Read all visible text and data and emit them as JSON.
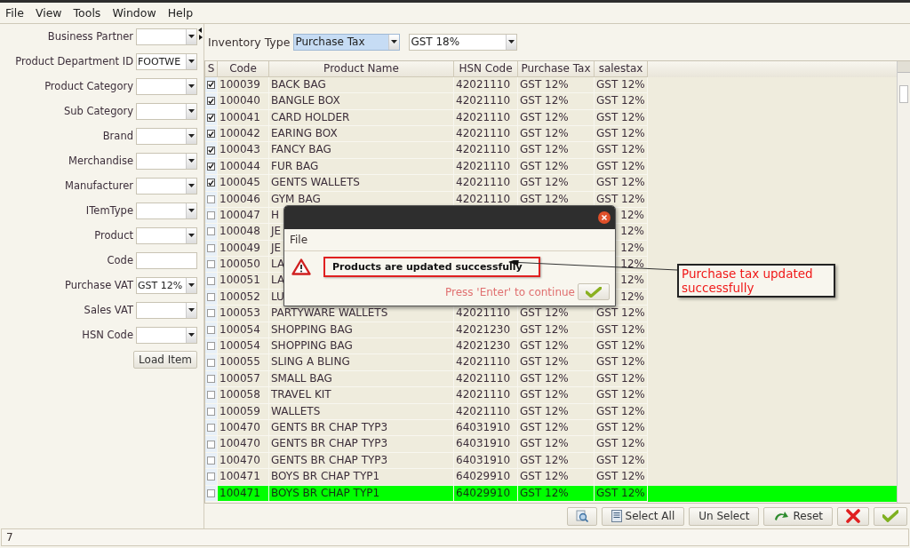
{
  "menu": [
    {
      "label": "File"
    },
    {
      "label": "View"
    },
    {
      "label": "Tools"
    },
    {
      "label": "Window"
    },
    {
      "label": "Help"
    }
  ],
  "filters": [
    {
      "label": "Business Partner",
      "kind": "combo"
    },
    {
      "label": "Product Department ID",
      "kind": "combo",
      "value": "FOOTWE"
    },
    {
      "label": "Product Category",
      "kind": "combo"
    },
    {
      "label": "Sub Category",
      "kind": "combo"
    },
    {
      "label": "Brand",
      "kind": "combo"
    },
    {
      "label": "Merchandise",
      "kind": "combo"
    },
    {
      "label": "Manufacturer",
      "kind": "combo"
    },
    {
      "label": "ITemType",
      "kind": "combo"
    },
    {
      "label": "Product",
      "kind": "combo"
    },
    {
      "label": "Code",
      "kind": "text"
    },
    {
      "label": "Purchase VAT",
      "kind": "combo",
      "value": "GST 12%"
    },
    {
      "label": "Sales VAT",
      "kind": "combo"
    },
    {
      "label": "HSN Code",
      "kind": "combo"
    }
  ],
  "load_button": "Load Item",
  "inventory": {
    "label": "Inventory Type",
    "type_value": "Purchase Tax",
    "tax_value": "GST 18%"
  },
  "table": {
    "columns": [
      "S",
      "Code",
      "Product Name",
      "HSN Code",
      "Purchase Tax",
      "salestax"
    ],
    "rows": [
      {
        "checked": true,
        "selected": false,
        "code": "100039",
        "name": "BACK BAG",
        "hsn": "42021110",
        "purchase_tax": "GST 12%",
        "salestax": "GST 12%"
      },
      {
        "checked": true,
        "selected": false,
        "code": "100040",
        "name": "BANGLE BOX",
        "hsn": "42021110",
        "purchase_tax": "GST 12%",
        "salestax": "GST 12%"
      },
      {
        "checked": true,
        "selected": false,
        "code": "100041",
        "name": "CARD HOLDER",
        "hsn": "42021110",
        "purchase_tax": "GST 12%",
        "salestax": "GST 12%"
      },
      {
        "checked": true,
        "selected": false,
        "code": "100042",
        "name": "EARING BOX",
        "hsn": "42021110",
        "purchase_tax": "GST 12%",
        "salestax": "GST 12%"
      },
      {
        "checked": true,
        "selected": false,
        "code": "100043",
        "name": "FANCY BAG",
        "hsn": "42021110",
        "purchase_tax": "GST 12%",
        "salestax": "GST 12%"
      },
      {
        "checked": true,
        "selected": false,
        "code": "100044",
        "name": "FUR BAG",
        "hsn": "42021110",
        "purchase_tax": "GST 12%",
        "salestax": "GST 12%"
      },
      {
        "checked": true,
        "selected": false,
        "code": "100045",
        "name": "GENTS WALLETS",
        "hsn": "42021110",
        "purchase_tax": "GST 12%",
        "salestax": "GST 12%"
      },
      {
        "checked": false,
        "selected": false,
        "code": "100046",
        "name": "GYM BAG",
        "hsn": "42021110",
        "purchase_tax": "GST 12%",
        "salestax": "GST 12%"
      },
      {
        "checked": false,
        "selected": false,
        "code": "100047",
        "name": "H",
        "salestax": "12%"
      },
      {
        "checked": false,
        "selected": false,
        "code": "100048",
        "name": "JE",
        "salestax": "12%"
      },
      {
        "checked": false,
        "selected": false,
        "code": "100049",
        "name": "JE",
        "salestax": "12%"
      },
      {
        "checked": false,
        "selected": false,
        "code": "100050",
        "name": "LA",
        "salestax": "12%"
      },
      {
        "checked": false,
        "selected": false,
        "code": "100051",
        "name": "LA",
        "salestax": "12%"
      },
      {
        "checked": false,
        "selected": false,
        "code": "100052",
        "name": "LU",
        "salestax": "12%"
      },
      {
        "checked": false,
        "selected": false,
        "code": "100053",
        "name": "PARTYWARE WALLETS",
        "hsn": "42021110",
        "purchase_tax": "GST 12%",
        "salestax": "GST 12%"
      },
      {
        "checked": false,
        "selected": false,
        "code": "100054",
        "name": "SHOPPING BAG",
        "hsn": "42021230",
        "purchase_tax": "GST 12%",
        "salestax": "GST 12%"
      },
      {
        "checked": false,
        "selected": false,
        "code": "100054",
        "name": "SHOPPING BAG",
        "hsn": "42021230",
        "purchase_tax": "GST 12%",
        "salestax": "GST 12%"
      },
      {
        "checked": false,
        "selected": false,
        "code": "100055",
        "name": "SLING A BLING",
        "hsn": "42021110",
        "purchase_tax": "GST 12%",
        "salestax": "GST 12%"
      },
      {
        "checked": false,
        "selected": false,
        "code": "100057",
        "name": "SMALL BAG",
        "hsn": "42021110",
        "purchase_tax": "GST 12%",
        "salestax": "GST 12%"
      },
      {
        "checked": false,
        "selected": false,
        "code": "100058",
        "name": "TRAVEL KIT",
        "hsn": "42021110",
        "purchase_tax": "GST 12%",
        "salestax": "GST 12%"
      },
      {
        "checked": false,
        "selected": false,
        "code": "100059",
        "name": "WALLETS",
        "hsn": "42021110",
        "purchase_tax": "GST 12%",
        "salestax": "GST 12%"
      },
      {
        "checked": false,
        "selected": false,
        "code": "100470",
        "name": "GENTS BR CHAP TYP3",
        "hsn": "64031910",
        "purchase_tax": "GST 12%",
        "salestax": "GST 12%"
      },
      {
        "checked": false,
        "selected": false,
        "code": "100470",
        "name": "GENTS BR CHAP TYP3",
        "hsn": "64031910",
        "purchase_tax": "GST 12%",
        "salestax": "GST 12%"
      },
      {
        "checked": false,
        "selected": false,
        "code": "100470",
        "name": "GENTS BR CHAP TYP3",
        "hsn": "64031910",
        "purchase_tax": "GST 12%",
        "salestax": "GST 12%"
      },
      {
        "checked": false,
        "selected": false,
        "code": "100471",
        "name": "BOYS BR CHAP TYP1",
        "hsn": "64029910",
        "purchase_tax": "GST 12%",
        "salestax": "GST 12%"
      },
      {
        "checked": false,
        "selected": true,
        "code": "100471",
        "name": "BOYS BR CHAP TYP1",
        "hsn": "64029910",
        "purchase_tax": "GST 12%",
        "salestax": "GST 12%"
      }
    ]
  },
  "actions": [
    {
      "kind": "search"
    },
    {
      "kind": "selectall",
      "label": "Select All"
    },
    {
      "kind": "text",
      "label": "Un Select"
    },
    {
      "kind": "reset",
      "label": "Reset"
    },
    {
      "kind": "cancel"
    },
    {
      "kind": "ok"
    }
  ],
  "status_bar": "7",
  "dialog": {
    "menu": "File",
    "message": "Products are updated successfully",
    "hint": "Press 'Enter' to continue"
  },
  "callout": "Purchase tax updated successfully"
}
